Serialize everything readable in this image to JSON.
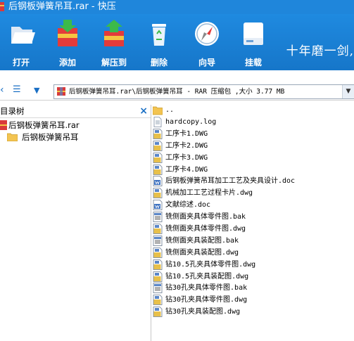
{
  "window": {
    "title": "后钢板弹簧吊耳.rar - 快压"
  },
  "toolbar": {
    "open": "打开",
    "add": "添加",
    "extract": "解压到",
    "delete": "删除",
    "wizard": "向导",
    "mount": "挂载",
    "slogan": "十年磨一剑,"
  },
  "address": {
    "path": "后钢板弹簧吊耳.rar\\后钢板弹簧吊耳 - RAR 压缩包 ,大小 3.77 MB"
  },
  "left_panel": {
    "title": "目录树",
    "tree": [
      {
        "label": "后钢板弹簧吊耳.rar",
        "icon": "rar-archive-icon"
      },
      {
        "label": "后钢板弹簧吊耳",
        "icon": "folder-icon"
      }
    ]
  },
  "files": [
    {
      "name": "..",
      "icon": "folder-up-icon"
    },
    {
      "name": "hardcopy.log",
      "icon": "text-file-icon"
    },
    {
      "name": "工序卡1.DWG",
      "icon": "dwg-file-icon"
    },
    {
      "name": "工序卡2.DWG",
      "icon": "dwg-file-icon"
    },
    {
      "name": "工序卡3.DWG",
      "icon": "dwg-file-icon"
    },
    {
      "name": "工序卡4.DWG",
      "icon": "dwg-file-icon"
    },
    {
      "name": "后钢板弹簧吊耳加工工艺及夹具设计.doc",
      "icon": "doc-file-icon"
    },
    {
      "name": "机械加工工艺过程卡片.dwg",
      "icon": "dwg-file-icon"
    },
    {
      "name": "文献综述.doc",
      "icon": "doc-file-icon"
    },
    {
      "name": "铣侧面夹具体零件图.bak",
      "icon": "bak-file-icon"
    },
    {
      "name": "铣侧面夹具体零件图.dwg",
      "icon": "dwg-file-icon"
    },
    {
      "name": "铣侧面夹具装配图.bak",
      "icon": "bak-file-icon"
    },
    {
      "name": "铣侧面夹具装配图.dwg",
      "icon": "dwg-file-icon"
    },
    {
      "name": "钻10.5孔夹具体零件图.dwg",
      "icon": "dwg-file-icon"
    },
    {
      "name": "钻10.5孔夹具装配图.dwg",
      "icon": "dwg-file-icon"
    },
    {
      "name": "钻30孔夹具体零件图.bak",
      "icon": "bak-file-icon"
    },
    {
      "name": "钻30孔夹具体零件图.dwg",
      "icon": "dwg-file-icon"
    },
    {
      "name": "钻30孔夹具装配图.dwg",
      "icon": "dwg-file-icon"
    }
  ],
  "colors": {
    "accent": "#1f86db",
    "selection": "#cde5ff"
  }
}
